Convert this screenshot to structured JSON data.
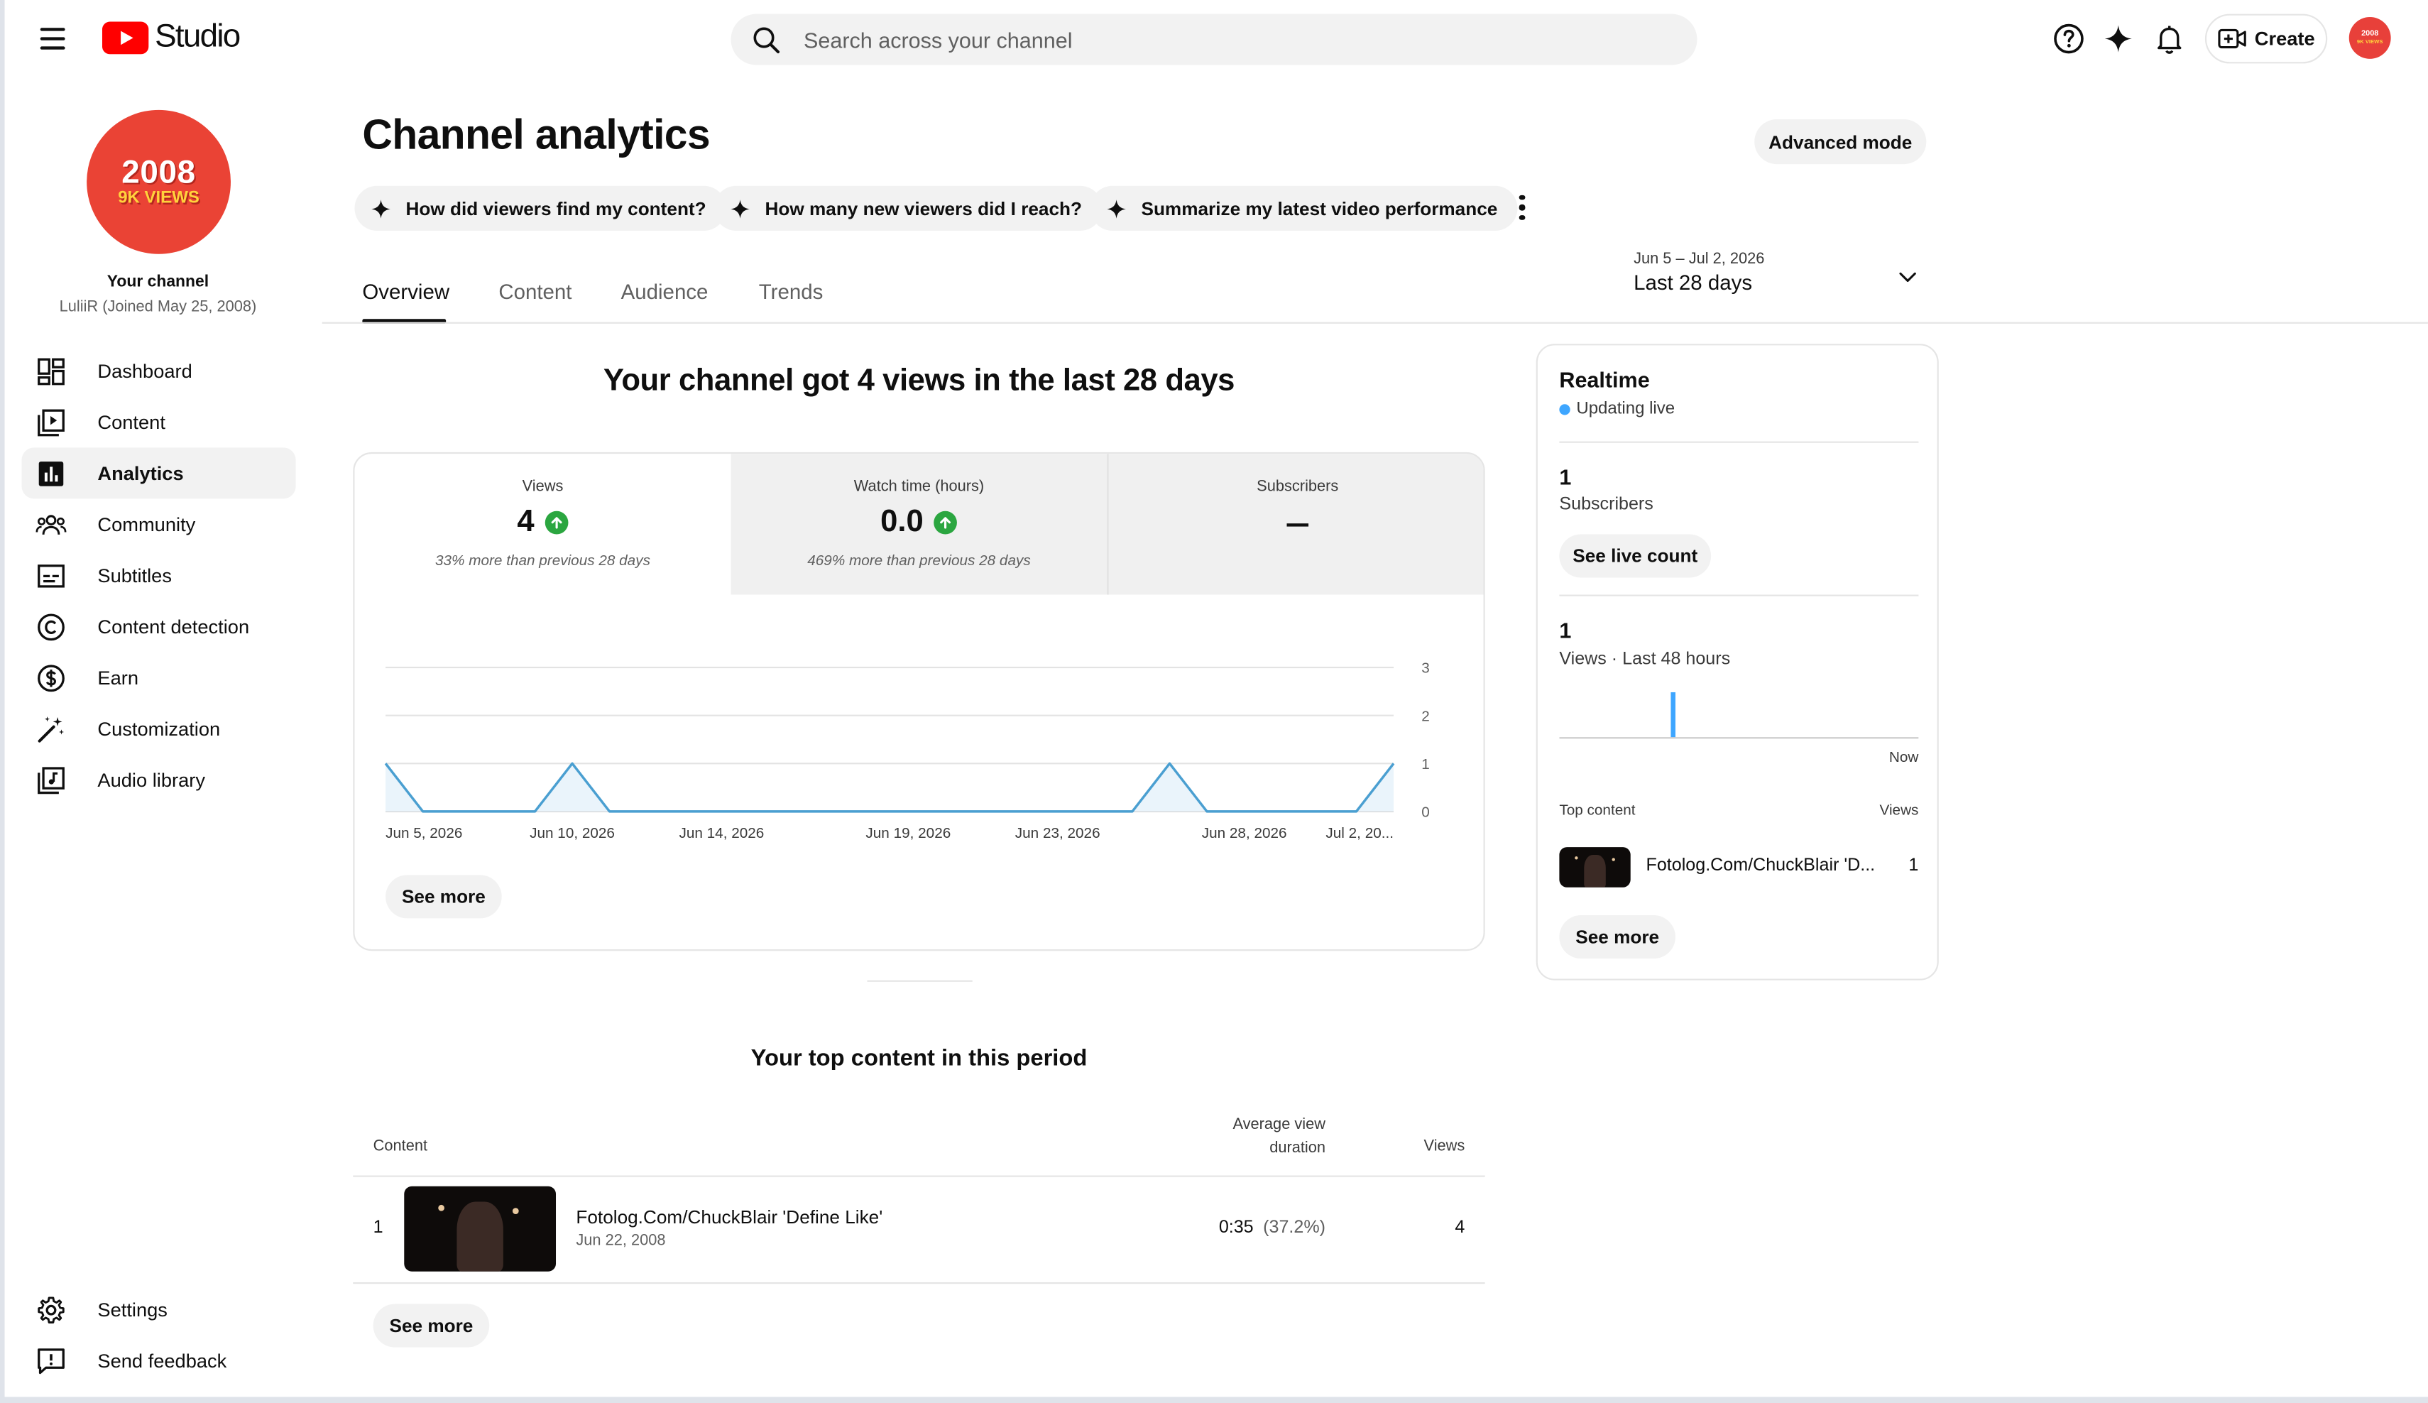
{
  "app": {
    "logo_text": "Studio",
    "search_placeholder": "Search across your channel",
    "create_label": "Create",
    "avatar_line1": "2008",
    "avatar_line2": "9K VIEWS"
  },
  "sidebar": {
    "avatar_year": "2008",
    "avatar_views": "9K VIEWS",
    "your_channel": "Your channel",
    "channel_sub": "LuliiR (Joined May 25, 2008)",
    "items": [
      {
        "label": "Dashboard",
        "icon": "dashboard-icon"
      },
      {
        "label": "Content",
        "icon": "content-icon"
      },
      {
        "label": "Analytics",
        "icon": "analytics-icon",
        "active": true
      },
      {
        "label": "Community",
        "icon": "community-icon"
      },
      {
        "label": "Subtitles",
        "icon": "subtitles-icon"
      },
      {
        "label": "Content detection",
        "icon": "copyright-icon"
      },
      {
        "label": "Earn",
        "icon": "dollar-icon"
      },
      {
        "label": "Customization",
        "icon": "magic-wand-icon"
      },
      {
        "label": "Audio library",
        "icon": "audio-library-icon"
      }
    ],
    "bottom_items": [
      {
        "label": "Settings",
        "icon": "gear-icon"
      },
      {
        "label": "Send feedback",
        "icon": "feedback-icon"
      }
    ]
  },
  "main": {
    "title": "Channel analytics",
    "advanced_mode": "Advanced mode",
    "chips": [
      "How did viewers find my content?",
      "How many new viewers did I reach?",
      "Summarize my latest video performance"
    ],
    "tabs": [
      "Overview",
      "Content",
      "Audience",
      "Trends"
    ],
    "active_tab": "Overview",
    "date_range": {
      "range": "Jun 5 – Jul 2, 2026",
      "label": "Last 28 days"
    },
    "headline": "Your channel got 4 views in the last 28 days",
    "metrics": [
      {
        "label": "Views",
        "value": "4",
        "trend": "up",
        "sub": "33% more than previous 28 days"
      },
      {
        "label": "Watch time (hours)",
        "value": "0.0",
        "trend": "up",
        "sub": "469% more than previous 28 days"
      },
      {
        "label": "Subscribers",
        "value": "",
        "trend": "none",
        "sub": ""
      }
    ],
    "see_more": "See more"
  },
  "chart_data": {
    "type": "area",
    "x": [
      "Jun 5, 2026",
      "Jun 6",
      "Jun 7",
      "Jun 8",
      "Jun 9",
      "Jun 10, 2026",
      "Jun 11",
      "Jun 12",
      "Jun 13",
      "Jun 14, 2026",
      "Jun 15",
      "Jun 16",
      "Jun 17",
      "Jun 18",
      "Jun 19, 2026",
      "Jun 20",
      "Jun 21",
      "Jun 22",
      "Jun 23, 2026",
      "Jun 24",
      "Jun 25",
      "Jun 26",
      "Jun 27",
      "Jun 28, 2026",
      "Jun 29",
      "Jun 30",
      "Jul 1",
      "Jul 2, 2026"
    ],
    "values": [
      1,
      0,
      0,
      0,
      0,
      1,
      0,
      0,
      0,
      0,
      0,
      0,
      0,
      0,
      0,
      0,
      0,
      0,
      0,
      0,
      0,
      1,
      0,
      0,
      0,
      0,
      0,
      1
    ],
    "x_tick_labels": [
      "Jun 5, 2026",
      "Jun 10, 2026",
      "Jun 14, 2026",
      "Jun 19, 2026",
      "Jun 23, 2026",
      "Jun 28, 2026",
      "Jul 2, 20..."
    ],
    "x_tick_index": [
      0,
      5,
      9,
      14,
      18,
      23,
      27
    ],
    "y_ticks": [
      0,
      1,
      2,
      3
    ],
    "ylim": [
      0,
      3
    ],
    "color": "#4a9fd1",
    "fill": "#eaf4fb",
    "grid": true
  },
  "top_content": {
    "title": "Your top content in this period",
    "col_content": "Content",
    "col_avd_1": "Average view",
    "col_avd_2": "duration",
    "col_views": "Views",
    "rows": [
      {
        "rank": "1",
        "title": "Fotolog.Com/ChuckBlair 'Define Like'",
        "date": "Jun 22, 2008",
        "avd": "0:35",
        "avd_pct": "(37.2%)",
        "views": "4"
      }
    ],
    "see_more": "See more"
  },
  "realtime": {
    "title": "Realtime",
    "live": "Updating live",
    "subs_value": "1",
    "subs_label": "Subscribers",
    "see_live_count": "See live count",
    "views_value": "1",
    "views_label": "Views · Last 48 hours",
    "now_label": "Now",
    "top_content_label": "Top content",
    "views_col": "Views",
    "top_item_title": "Fotolog.Com/ChuckBlair 'D...",
    "top_item_views": "1",
    "see_more": "See more",
    "bar_color": "#3ea6ff"
  }
}
